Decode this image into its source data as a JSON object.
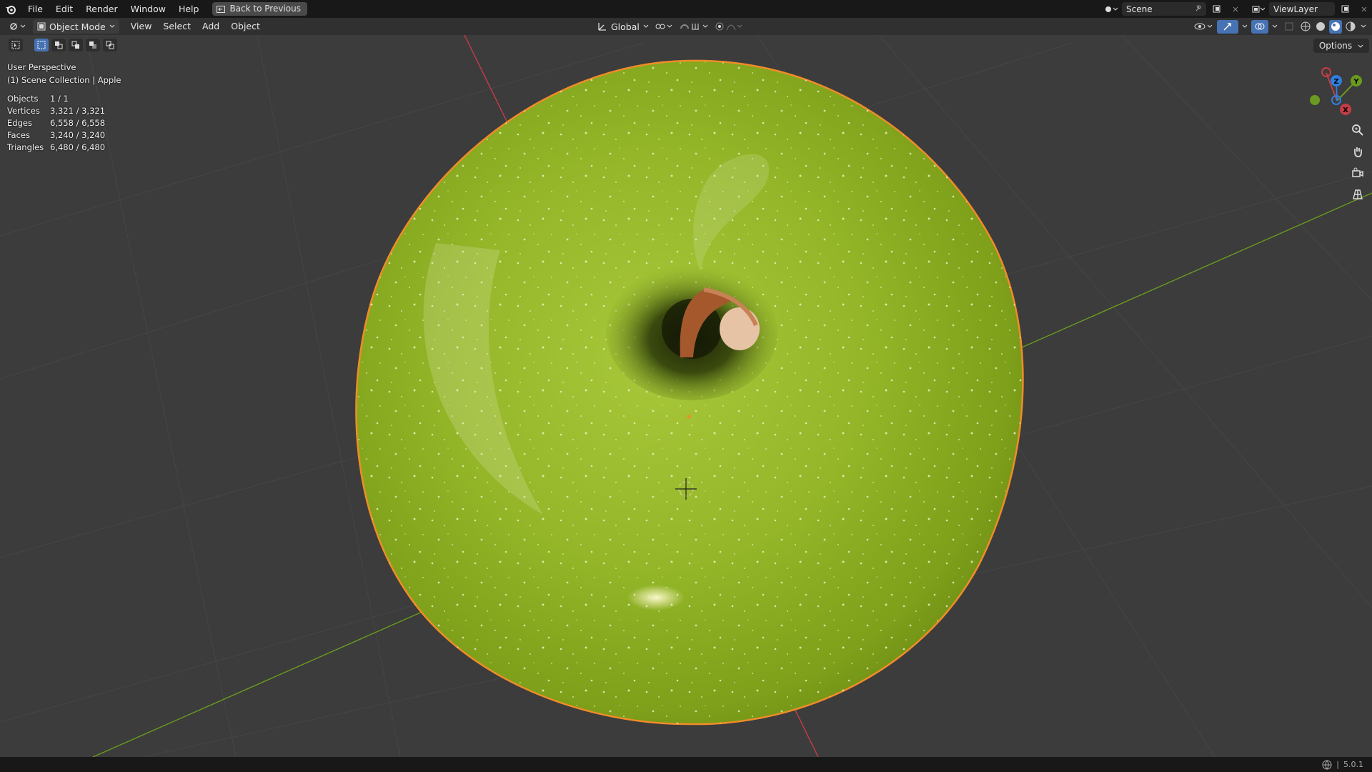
{
  "app": {
    "name": "Blender",
    "version": "5.0.1"
  },
  "topbar": {
    "menus": [
      "File",
      "Edit",
      "Render",
      "Window",
      "Help"
    ],
    "back_button": "Back to Previous",
    "scene_name": "Scene",
    "view_layer": "ViewLayer"
  },
  "header": {
    "mode": "Object Mode",
    "menus": [
      "View",
      "Select",
      "Add",
      "Object"
    ],
    "transform_orientation": "Global",
    "options_label": "Options"
  },
  "viewport": {
    "perspective": "User Perspective",
    "collection_info": "(1) Scene Collection | Apple",
    "stats": [
      {
        "label": "Objects",
        "value": "1 / 1"
      },
      {
        "label": "Vertices",
        "value": "3,321 / 3,321"
      },
      {
        "label": "Edges",
        "value": "6,558 / 6,558"
      },
      {
        "label": "Faces",
        "value": "3,240 / 3,240"
      },
      {
        "label": "Triangles",
        "value": "6,480 / 6,480"
      }
    ],
    "gizmo_axes": [
      "X",
      "Y",
      "Z"
    ]
  },
  "statusbar": {
    "version": "5.0.1"
  },
  "colors": {
    "apple": "#8fb320",
    "selection_outline": "#f08c28",
    "axis_x": "#c43d46",
    "axis_y": "#6a9a1f",
    "axis_z": "#2f7fe0"
  }
}
